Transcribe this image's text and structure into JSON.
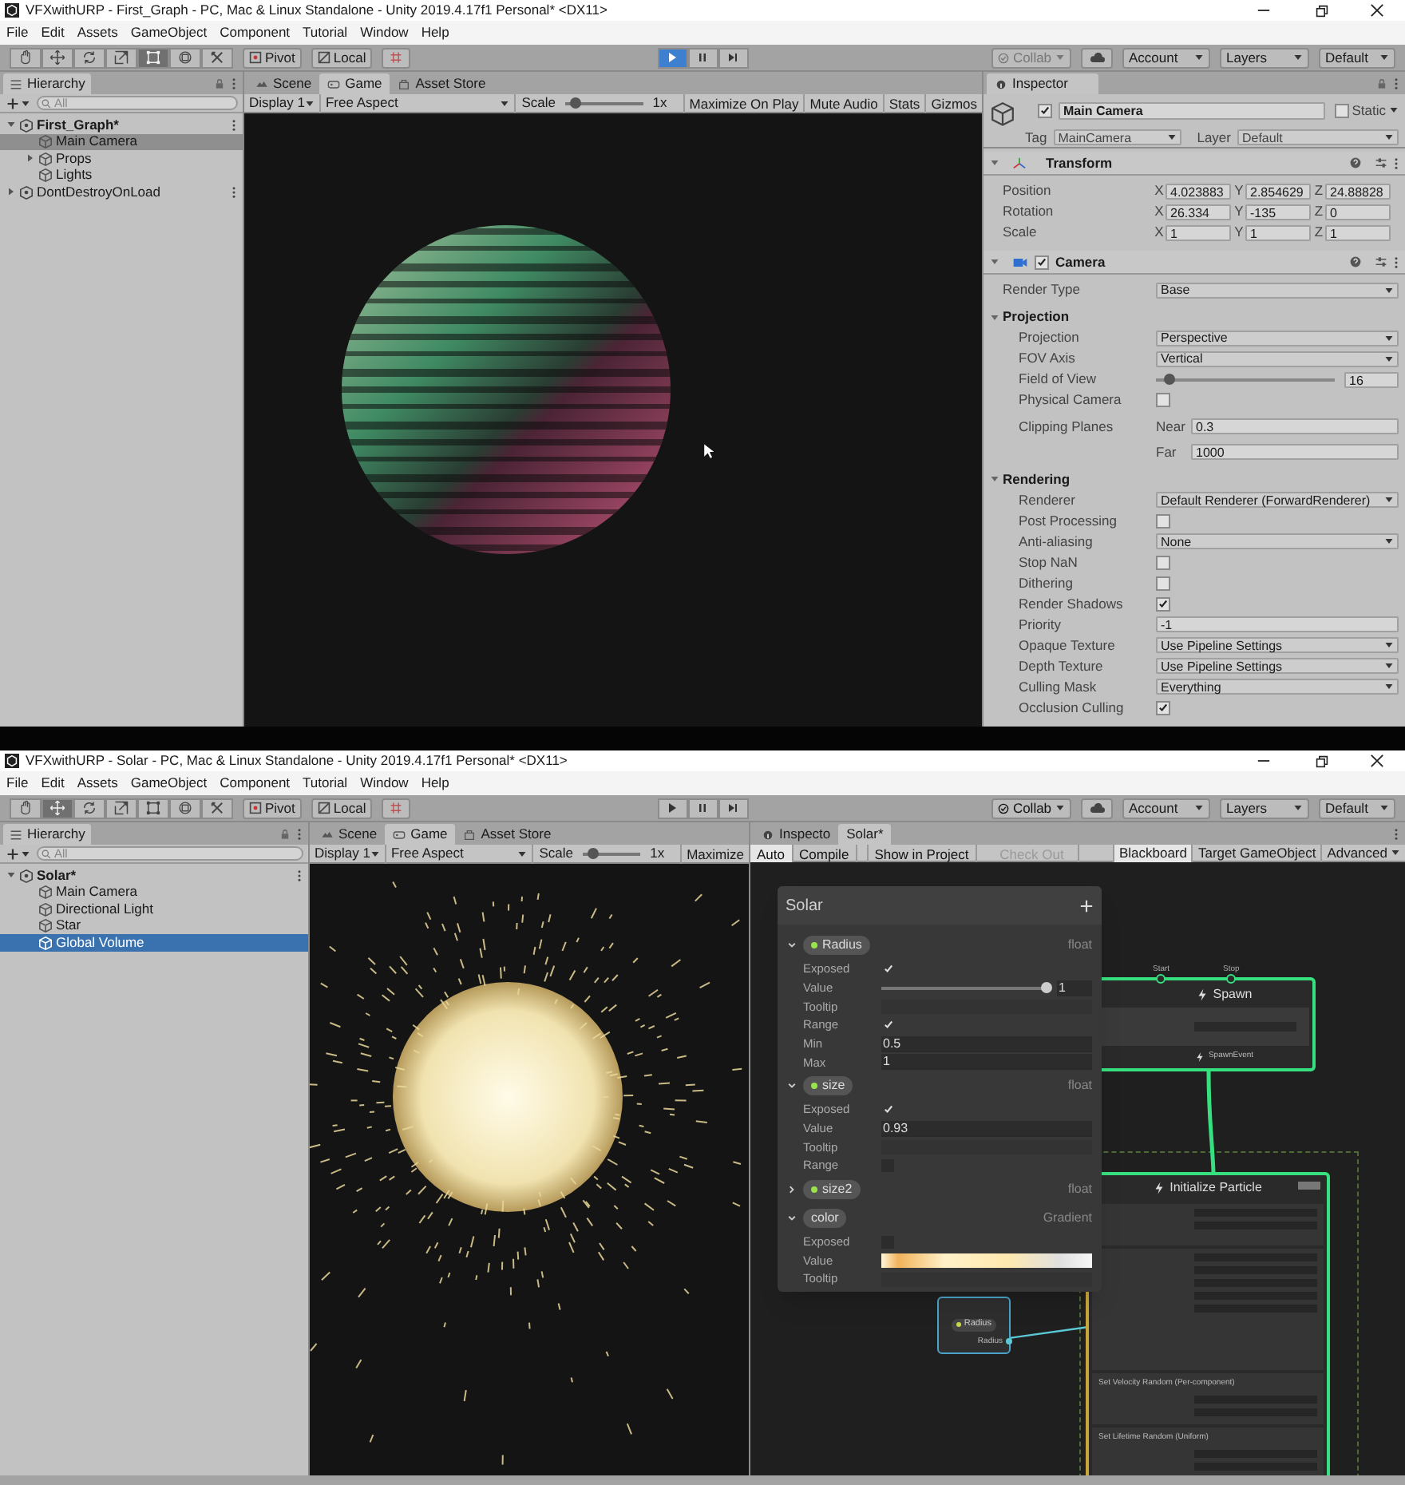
{
  "top_window": {
    "title": "VFXwithURP - First_Graph - PC, Mac & Linux Standalone - Unity 2019.4.17f1 Personal* <DX11>",
    "menu": [
      "File",
      "Edit",
      "Assets",
      "GameObject",
      "Component",
      "Tutorial",
      "Window",
      "Help"
    ],
    "toolbar": {
      "tools": [
        {
          "kind": "hand",
          "selected": false
        },
        {
          "kind": "move",
          "selected": false
        },
        {
          "kind": "rotate",
          "selected": false
        },
        {
          "kind": "scale",
          "selected": false
        },
        {
          "kind": "rect",
          "selected": true
        },
        {
          "kind": "transform",
          "selected": false
        },
        {
          "kind": "custom",
          "selected": false
        }
      ],
      "pivot": "Pivot",
      "local": "Local",
      "play": [
        {
          "kind": "play",
          "selected": true
        },
        {
          "kind": "pause",
          "selected": false
        },
        {
          "kind": "step",
          "selected": false
        }
      ],
      "collab": {
        "label": "Collab",
        "disabled": true
      },
      "account": "Account",
      "layers": "Layers",
      "layout": "Default"
    },
    "hierarchy": {
      "tab": "Hierarchy",
      "search_placeholder": "All",
      "focused": false,
      "tree": [
        {
          "label": "First_Graph*",
          "kind": "scene",
          "expanded": true,
          "selected": false,
          "children": [
            {
              "label": "Main Camera",
              "kind": "object",
              "selected": true
            },
            {
              "label": "Props",
              "kind": "object",
              "expanded": false,
              "selected": false
            },
            {
              "label": "Lights",
              "kind": "object",
              "selected": false
            }
          ]
        },
        {
          "label": "DontDestroyOnLoad",
          "kind": "system_scene",
          "expanded": false,
          "selected": false
        }
      ]
    },
    "game": {
      "tabs": [
        {
          "label": "Scene",
          "kind": "scene",
          "selected": false
        },
        {
          "label": "Game",
          "kind": "game",
          "selected": true
        },
        {
          "label": "Asset Store",
          "kind": "store",
          "selected": false
        }
      ],
      "display": "Display 1",
      "aspect": "Free Aspect",
      "scale_label": "Scale",
      "scale": {
        "level": 0.05
      },
      "scale_value": "1x",
      "toggles": [
        "Maximize On Play",
        "Mute Audio",
        "Stats",
        "Gizmos"
      ]
    },
    "inspector": {
      "tab": "Inspector",
      "object": {
        "name": "Main Camera",
        "active": true,
        "static_label": "Static",
        "static": false,
        "tag_label": "Tag",
        "tag": "MainCamera",
        "layer_label": "Layer",
        "layer": "Default"
      },
      "components": [
        {
          "kind": "transform",
          "title": "Transform",
          "expanded": true,
          "rows": [
            {
              "label": "Position",
              "axes": [
                {
                  "axis": "X",
                  "value": "4.023883"
                },
                {
                  "axis": "Y",
                  "value": "2.854629"
                },
                {
                  "axis": "Z",
                  "value": "24.88828"
                }
              ]
            },
            {
              "label": "Rotation",
              "axes": [
                {
                  "axis": "X",
                  "value": "26.334"
                },
                {
                  "axis": "Y",
                  "value": "-135"
                },
                {
                  "axis": "Z",
                  "value": "0"
                }
              ]
            },
            {
              "label": "Scale",
              "axes": [
                {
                  "axis": "X",
                  "value": "1"
                },
                {
                  "axis": "Y",
                  "value": "1"
                },
                {
                  "axis": "Z",
                  "value": "1"
                }
              ]
            }
          ]
        },
        {
          "kind": "camera",
          "title": "Camera",
          "enabled": true,
          "expanded": true,
          "rows": [
            {
              "kind": "dropdown",
              "label": "Render Type",
              "value": "Base"
            },
            {
              "kind": "section",
              "label": "Projection",
              "expanded": true,
              "children": [
                {
                  "kind": "dropdown",
                  "label": "Projection",
                  "value": "Perspective"
                },
                {
                  "kind": "dropdown",
                  "label": "FOV Axis",
                  "value": "Vertical"
                },
                {
                  "kind": "slider",
                  "label": "Field of View",
                  "level": 0.07,
                  "value": "16"
                },
                {
                  "kind": "checkbox",
                  "label": "Physical Camera",
                  "checked": false
                },
                {
                  "kind": "clip",
                  "label": "Clipping Planes",
                  "near_label": "Near",
                  "near": "0.3",
                  "far_label": "Far",
                  "far": "1000"
                }
              ]
            },
            {
              "kind": "section",
              "label": "Rendering",
              "expanded": true,
              "children": [
                {
                  "kind": "dropdown",
                  "label": "Renderer",
                  "value": "Default Renderer (ForwardRenderer)"
                },
                {
                  "kind": "checkbox",
                  "label": "Post Processing",
                  "checked": false
                },
                {
                  "kind": "dropdown",
                  "label": "Anti-aliasing",
                  "value": "None"
                },
                {
                  "kind": "checkbox",
                  "label": "Stop NaN",
                  "checked": false
                },
                {
                  "kind": "checkbox",
                  "label": "Dithering",
                  "checked": false
                },
                {
                  "kind": "checkbox",
                  "label": "Render Shadows",
                  "checked": true
                },
                {
                  "kind": "field",
                  "label": "Priority",
                  "value": "-1"
                },
                {
                  "kind": "dropdown",
                  "label": "Opaque Texture",
                  "value": "Use Pipeline Settings"
                },
                {
                  "kind": "dropdown",
                  "label": "Depth Texture",
                  "value": "Use Pipeline Settings"
                },
                {
                  "kind": "dropdown",
                  "label": "Culling Mask",
                  "value": "Everything"
                },
                {
                  "kind": "checkbox",
                  "label": "Occlusion Culling",
                  "checked": true
                }
              ]
            }
          ]
        }
      ]
    }
  },
  "bottom_window": {
    "title": "VFXwithURP - Solar - PC, Mac & Linux Standalone - Unity 2019.4.17f1 Personal* <DX11>",
    "menu": [
      "File",
      "Edit",
      "Assets",
      "GameObject",
      "Component",
      "Tutorial",
      "Window",
      "Help"
    ],
    "toolbar": {
      "tools": [
        {
          "kind": "hand",
          "selected": false
        },
        {
          "kind": "move",
          "selected": true
        },
        {
          "kind": "rotate",
          "selected": false
        },
        {
          "kind": "scale",
          "selected": false
        },
        {
          "kind": "rect",
          "selected": false
        },
        {
          "kind": "transform",
          "selected": false
        },
        {
          "kind": "custom",
          "selected": false
        }
      ],
      "pivot": "Pivot",
      "local": "Local",
      "play": [
        {
          "kind": "play",
          "selected": false
        },
        {
          "kind": "pause",
          "selected": false
        },
        {
          "kind": "step",
          "selected": false
        }
      ],
      "collab": {
        "label": "Collab",
        "disabled": false
      },
      "account": "Account",
      "layers": "Layers",
      "layout": "Default"
    },
    "hierarchy": {
      "tab": "Hierarchy",
      "search_placeholder": "All",
      "focused": true,
      "tree": [
        {
          "label": "Solar*",
          "kind": "scene",
          "expanded": true,
          "selected": false,
          "children": [
            {
              "label": "Main Camera",
              "kind": "object",
              "selected": false
            },
            {
              "label": "Directional Light",
              "kind": "object",
              "selected": false
            },
            {
              "label": "Star",
              "kind": "object",
              "selected": false
            },
            {
              "label": "Global Volume",
              "kind": "object",
              "selected": true
            }
          ]
        }
      ]
    },
    "game": {
      "tabs": [
        {
          "label": "Scene",
          "kind": "scene",
          "selected": false
        },
        {
          "label": "Game",
          "kind": "game",
          "selected": true
        },
        {
          "label": "Asset Store",
          "kind": "store",
          "selected": false
        }
      ],
      "display": "Display 1",
      "aspect": "Free Aspect",
      "scale_label": "Scale",
      "scale": {
        "level": 0.05
      },
      "scale_value": "1x",
      "toggles": [
        "Maximize"
      ]
    },
    "graph_panel": {
      "tabs": [
        {
          "label": "Inspecto",
          "kind": "inspector",
          "selected": false
        },
        {
          "label": "Solar*",
          "kind": "graph",
          "selected": true
        }
      ],
      "toolbar_left": [
        {
          "label": "Auto",
          "selected": true,
          "disabled": false
        },
        {
          "label": "Compile",
          "selected": false,
          "disabled": false
        },
        {
          "label": "Show in Project",
          "selected": false,
          "disabled": false
        },
        {
          "label": "Check Out",
          "selected": false,
          "disabled": true
        }
      ],
      "toolbar_right": [
        {
          "label": "Blackboard",
          "kind": "toggle",
          "selected": true
        },
        {
          "label": "Target GameObject",
          "kind": "toggle",
          "selected": false
        },
        {
          "label": "Advanced",
          "kind": "dropdown",
          "selected": false
        }
      ],
      "blackboard": {
        "title": "Solar",
        "properties": [
          {
            "name": "Radius",
            "type": "float",
            "color": "#9be34d",
            "expanded": true,
            "rows": [
              {
                "kind": "checkbox",
                "label": "Exposed",
                "checked": true
              },
              {
                "kind": "slider",
                "label": "Value",
                "level": 1,
                "value": "1"
              },
              {
                "kind": "text",
                "label": "Tooltip"
              },
              {
                "kind": "checkbox",
                "label": "Range",
                "checked": true
              },
              {
                "kind": "field",
                "label": "Min",
                "value": "0.5"
              },
              {
                "kind": "field",
                "label": "Max",
                "value": "1"
              }
            ]
          },
          {
            "name": "size",
            "type": "float",
            "color": "#9be34d",
            "expanded": true,
            "rows": [
              {
                "kind": "checkbox",
                "label": "Exposed",
                "checked": true
              },
              {
                "kind": "field",
                "label": "Value",
                "value": "0.93"
              },
              {
                "kind": "text",
                "label": "Tooltip"
              },
              {
                "kind": "checkbox",
                "label": "Range",
                "checked": false
              }
            ]
          },
          {
            "name": "size2",
            "type": "float",
            "color": "#9be34d",
            "expanded": false
          },
          {
            "name": "color",
            "type": "Gradient",
            "expanded": true,
            "rows": [
              {
                "kind": "checkbox",
                "label": "Exposed",
                "checked": false
              },
              {
                "kind": "gradient",
                "label": "Value"
              },
              {
                "kind": "text",
                "label": "Tooltip"
              }
            ]
          }
        ]
      },
      "graph": {
        "spawn": {
          "title": "Spawn",
          "inputs": [
            "Start",
            "Stop"
          ],
          "output": "SpawnEvent"
        },
        "initialize": {
          "title": "Initialize Particle",
          "blocks": [
            "Set Velocity Random (Per-component)",
            "Set Lifetime Random (Uniform)"
          ]
        },
        "parameter": {
          "label": "Radius",
          "output": "Radius"
        }
      }
    }
  }
}
